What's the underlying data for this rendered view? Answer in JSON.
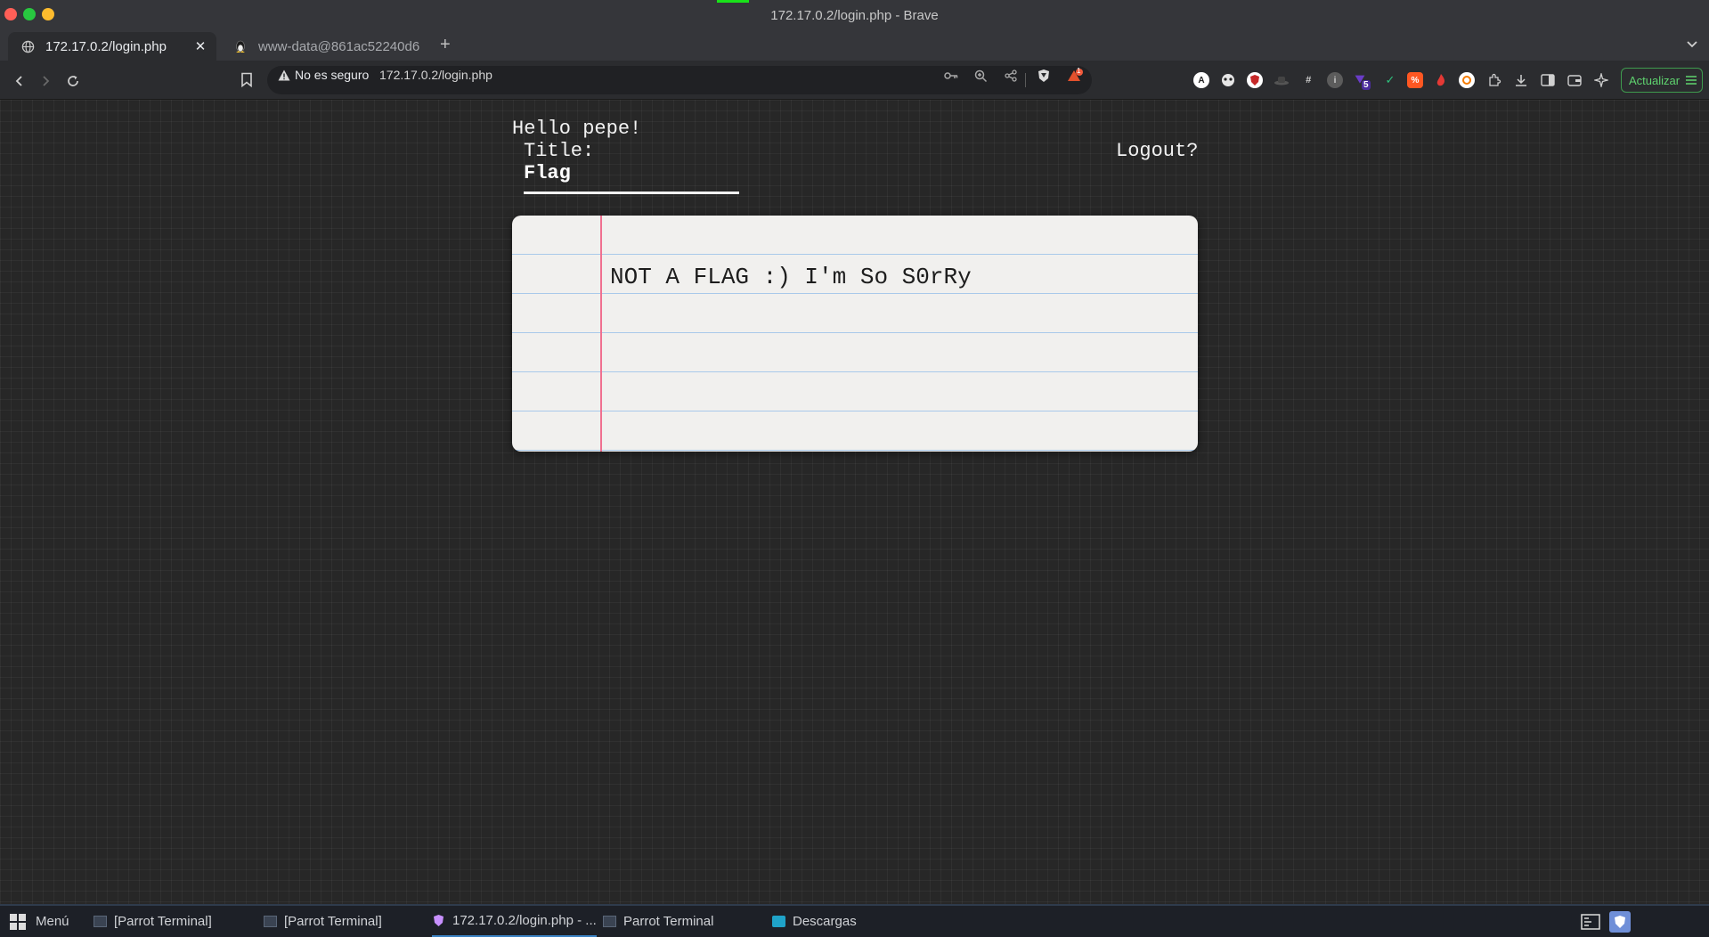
{
  "window": {
    "title": "172.17.0.2/login.php - Brave"
  },
  "tabs": [
    {
      "label": "172.17.0.2/login.php",
      "active": true
    },
    {
      "label": "www-data@861ac52240d6",
      "active": false
    }
  ],
  "toolbar": {
    "security_label": "No es seguro",
    "url": "172.17.0.2/login.php",
    "rewards_badge": "1",
    "ext_badge": "5",
    "update_label": "Actualizar"
  },
  "page": {
    "greeting": "Hello pepe!",
    "title_label": "Title:",
    "title_value": "Flag",
    "logout_label": "Logout?",
    "note_text": "NOT A FLAG :) I'm So S0rRy"
  },
  "taskbar": {
    "menu_label": "Menú",
    "items": [
      {
        "label": "[Parrot Terminal]"
      },
      {
        "label": "[Parrot Terminal]"
      },
      {
        "label": "172.17.0.2/login.php - ..."
      },
      {
        "label": "Parrot Terminal"
      },
      {
        "label": "Descargas"
      }
    ]
  },
  "colors": {
    "page_bg": "#272727",
    "paper_bg": "#f1f0ee",
    "ruled_line": "#a9c9ea",
    "margin_line": "#f07090",
    "update_accent": "#5fd36f"
  }
}
